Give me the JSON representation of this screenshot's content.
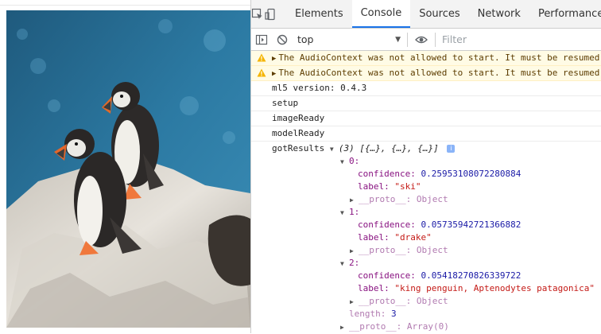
{
  "devtools": {
    "tabs": [
      {
        "label": "Elements",
        "active": false
      },
      {
        "label": "Console",
        "active": true
      },
      {
        "label": "Sources",
        "active": false
      },
      {
        "label": "Network",
        "active": false
      },
      {
        "label": "Performance",
        "active": false
      }
    ],
    "toolbar": {
      "context": "top",
      "filter_placeholder": "Filter"
    }
  },
  "console": {
    "warnings": [
      "The AudioContext was not allowed to start. It must be resumed",
      "The AudioContext was not allowed to start. It must be resumed"
    ],
    "logs": [
      "ml5 version: 0.4.3",
      "setup",
      "imageReady",
      "modelReady"
    ],
    "gotResults": {
      "label": "gotResults",
      "summary_count": "(3)",
      "summary_items": "[{…}, {…}, {…}]",
      "info_badge": "i",
      "items": [
        {
          "index": "0:",
          "confidence_key": "confidence:",
          "confidence": "0.25953108072280884",
          "label_key": "label:",
          "label": "\"ski\"",
          "proto": "__proto__: Object"
        },
        {
          "index": "1:",
          "confidence_key": "confidence:",
          "confidence": "0.05735942721366882",
          "label_key": "label:",
          "label": "\"drake\"",
          "proto": "__proto__: Object"
        },
        {
          "index": "2:",
          "confidence_key": "confidence:",
          "confidence": "0.05418270826339722",
          "label_key": "label:",
          "label": "\"king penguin, Aptenodytes patagonica\"",
          "proto": "__proto__: Object"
        }
      ],
      "length_key": "length:",
      "length": "3",
      "array_proto": "__proto__: Array(0)"
    }
  },
  "colors": {
    "accent": "#1a73e8",
    "warning_bg": "#fffbe5",
    "key": "#881280",
    "number": "#1a1aa6",
    "string": "#c41a16"
  }
}
